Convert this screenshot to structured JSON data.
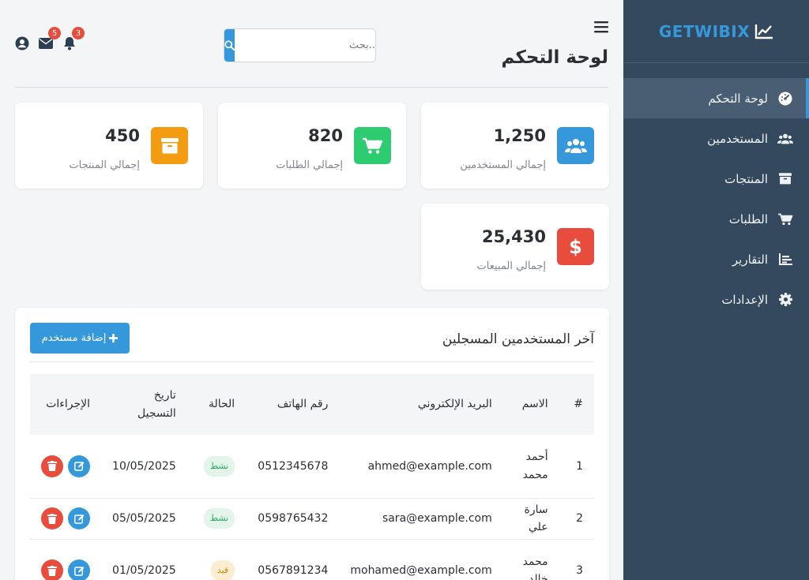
{
  "brand": {
    "name": "GETWIBIX",
    "icon": "chart-line-icon"
  },
  "sidebar": {
    "items": [
      {
        "label": "لوحة التحكم",
        "icon": "dashboard-gauge-icon",
        "active": true
      },
      {
        "label": "المستخدمين",
        "icon": "users-icon",
        "active": false
      },
      {
        "label": "المنتجات",
        "icon": "box-icon",
        "active": false
      },
      {
        "label": "الطلبات",
        "icon": "cart-icon",
        "active": false
      },
      {
        "label": "التقارير",
        "icon": "bar-chart-icon",
        "active": false
      },
      {
        "label": "الإعدادات",
        "icon": "gear-icon",
        "active": false
      }
    ]
  },
  "header": {
    "title": "لوحة التحكم",
    "search_placeholder": "بحث...",
    "notifications_count": "3",
    "messages_count": "5"
  },
  "stats": [
    {
      "value": "1,250",
      "label": "إجمالي المستخدمين",
      "icon": "users-icon",
      "color": "#3498db"
    },
    {
      "value": "820",
      "label": "إجمالي الطلبات",
      "icon": "cart-icon",
      "color": "#2ecc71"
    },
    {
      "value": "450",
      "label": "إجمالي المنتجات",
      "icon": "box-icon",
      "color": "#f39c12"
    },
    {
      "value": "25,430",
      "label": "إجمالي المبيعات",
      "icon": "dollar-icon",
      "color": "#e74c3c"
    }
  ],
  "users_section": {
    "title": "آخر المستخدمين المسجلين",
    "add_button": "إضافة مستخدم",
    "columns": [
      "#",
      "الاسم",
      "البريد الإلكتروني",
      "رقم الهاتف",
      "الحالة",
      "تاريخ التسجيل",
      "الإجراءات"
    ],
    "rows": [
      {
        "num": "1",
        "name": "أحمد محمد",
        "email": "ahmed@example.com",
        "phone": "0512345678",
        "status": "نشط",
        "date": "10/05/2025"
      },
      {
        "num": "2",
        "name": "سارة علي",
        "email": "sara@example.com",
        "phone": "0598765432",
        "status": "نشط",
        "date": "05/05/2025"
      },
      {
        "num": "3",
        "name": "محمد خالد",
        "email": "mohamed@example.com",
        "phone": "0567891234",
        "status": "قيد",
        "date": "01/05/2025"
      }
    ]
  },
  "colors": {
    "sidebar": "#34495e",
    "accent": "#3498db",
    "danger": "#e74c3c"
  }
}
